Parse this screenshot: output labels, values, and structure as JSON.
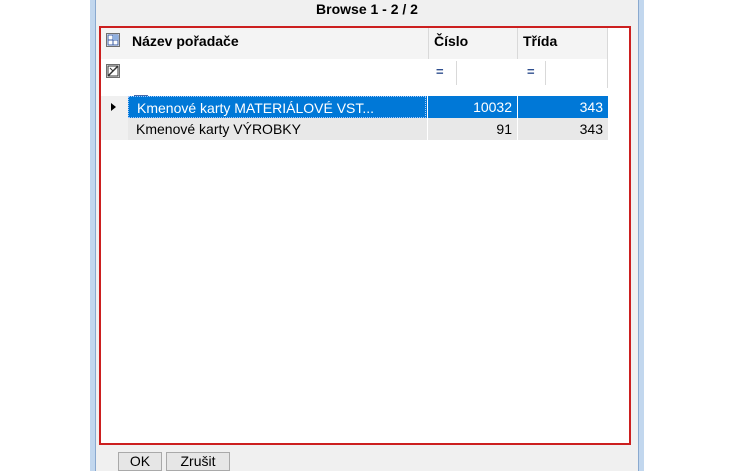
{
  "window": {
    "title": "Browse  1 - 2 / 2"
  },
  "grid": {
    "columns": [
      {
        "label": "Název pořadače"
      },
      {
        "label": "Číslo"
      },
      {
        "label": "Třída"
      }
    ],
    "filter_marks": {
      "cislo": "=",
      "trida": "="
    },
    "text_filter_icon": "A",
    "rows": [
      {
        "name": "Kmenové karty MATERIÁLOVÉ VST...",
        "cislo": "10032",
        "trida": "343",
        "selected": true
      },
      {
        "name": "Kmenové karty VÝROBKY",
        "cislo": "91",
        "trida": "343",
        "selected": false
      }
    ]
  },
  "buttons": {
    "ok": "OK",
    "cancel": "Zrušit"
  },
  "colors": {
    "selection": "#0078d7",
    "highlight_border": "#cc1f1f"
  }
}
